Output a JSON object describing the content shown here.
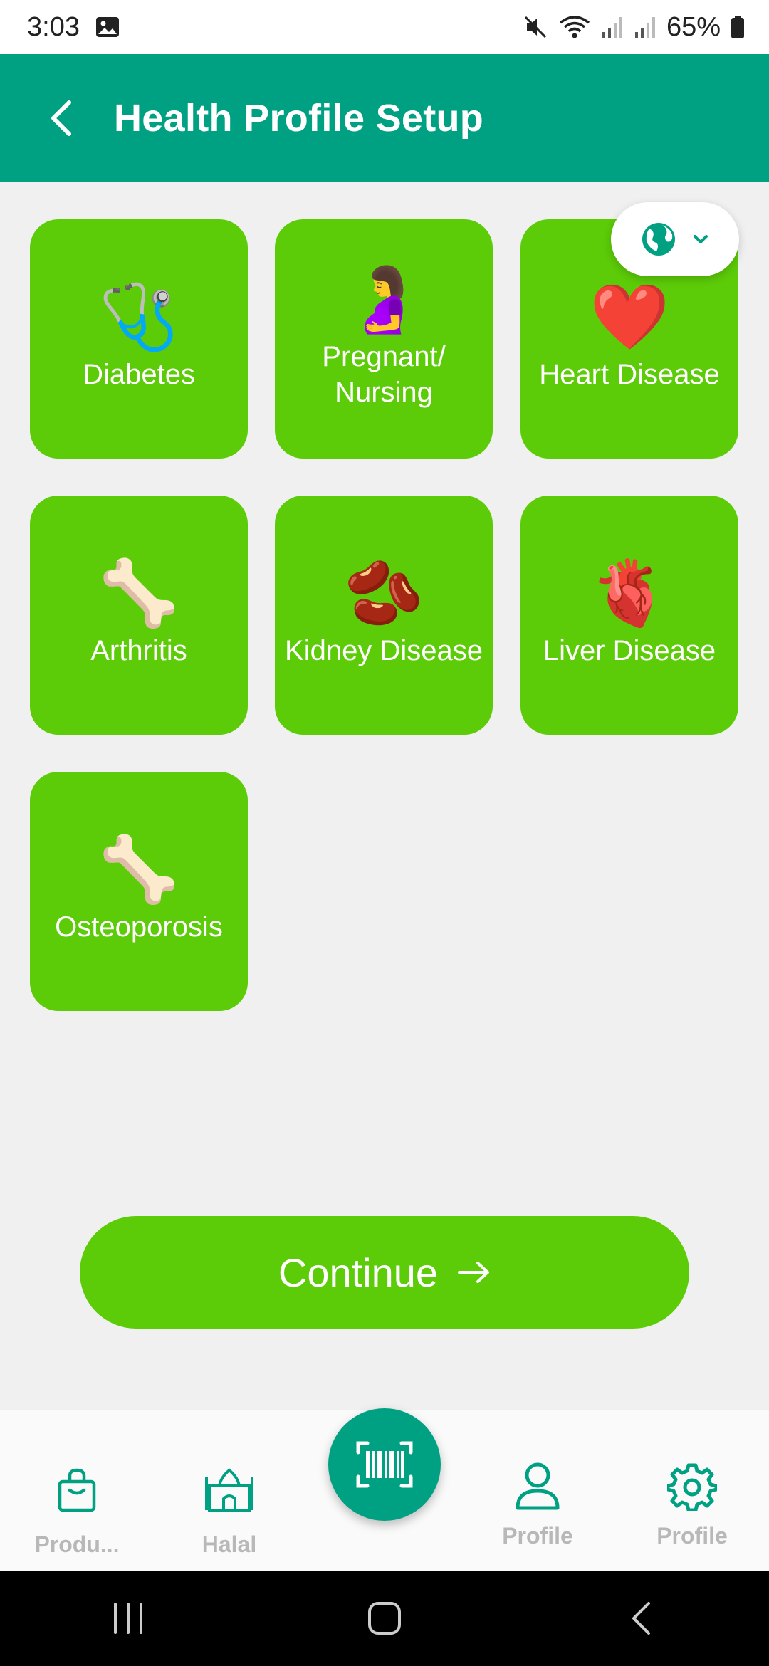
{
  "status_bar": {
    "time": "3:03",
    "battery": "65%",
    "icons": [
      "gallery-icon",
      "mute-icon",
      "wifi-icon",
      "signal-icon",
      "signal-icon",
      "battery-icon"
    ]
  },
  "header": {
    "title": "Health Profile Setup",
    "back_icon": "back-arrow-icon"
  },
  "language_selector": {
    "icon": "globe-icon",
    "chevron": "chevron-down-icon"
  },
  "conditions": [
    {
      "label": "Diabetes",
      "emoji": "🩺"
    },
    {
      "label": "Pregnant/\nNursing",
      "emoji": "🤰"
    },
    {
      "label": "Heart Disease",
      "emoji": "❤️"
    },
    {
      "label": "Arthritis",
      "emoji": "🦴"
    },
    {
      "label": "Kidney Disease",
      "emoji": "🫘"
    },
    {
      "label": "Liver Disease",
      "emoji": "🫀"
    },
    {
      "label": "Osteoporosis",
      "emoji": "🦴"
    }
  ],
  "continue_button": {
    "label": "Continue",
    "icon": "arrow-right-icon"
  },
  "bottom_nav": {
    "items": [
      {
        "label": "Produ...",
        "icon": "shopping-bag-icon"
      },
      {
        "label": "Halal",
        "icon": "mosque-icon"
      },
      {
        "label": "",
        "icon": "barcode-scan-icon"
      },
      {
        "label": "Profile",
        "icon": "user-icon"
      },
      {
        "label": "Profile",
        "icon": "gear-icon"
      }
    ]
  },
  "colors": {
    "primary": "#00a082",
    "tile": "#5ccb08",
    "background": "#f0f0f0",
    "nav_label": "#b8b8b8"
  }
}
